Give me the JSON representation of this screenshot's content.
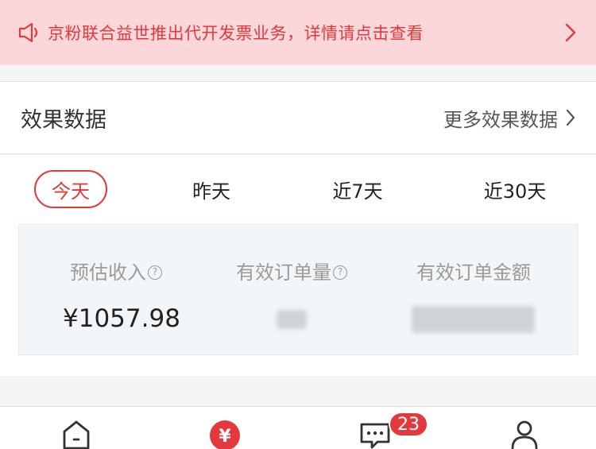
{
  "notice": {
    "text": "京粉联合益世推出代开发票业务，详情请点击查看"
  },
  "effect": {
    "title": "效果数据",
    "more_label": "更多效果数据"
  },
  "tabs": [
    {
      "label": "今天",
      "active": true
    },
    {
      "label": "昨天",
      "active": false
    },
    {
      "label": "近7天",
      "active": false
    },
    {
      "label": "近30天",
      "active": false
    }
  ],
  "stats": [
    {
      "label": "预估收入",
      "value": "¥1057.98",
      "help": "?"
    },
    {
      "label": "有效订单量",
      "value": "",
      "help": "?"
    },
    {
      "label": "有效订单金额",
      "value": ""
    }
  ],
  "nav": {
    "messages_badge": "23"
  },
  "colors": {
    "accent": "#e4393c",
    "notice_bg": "#fbd7d9",
    "stats_bg": "#f3f6f9"
  }
}
